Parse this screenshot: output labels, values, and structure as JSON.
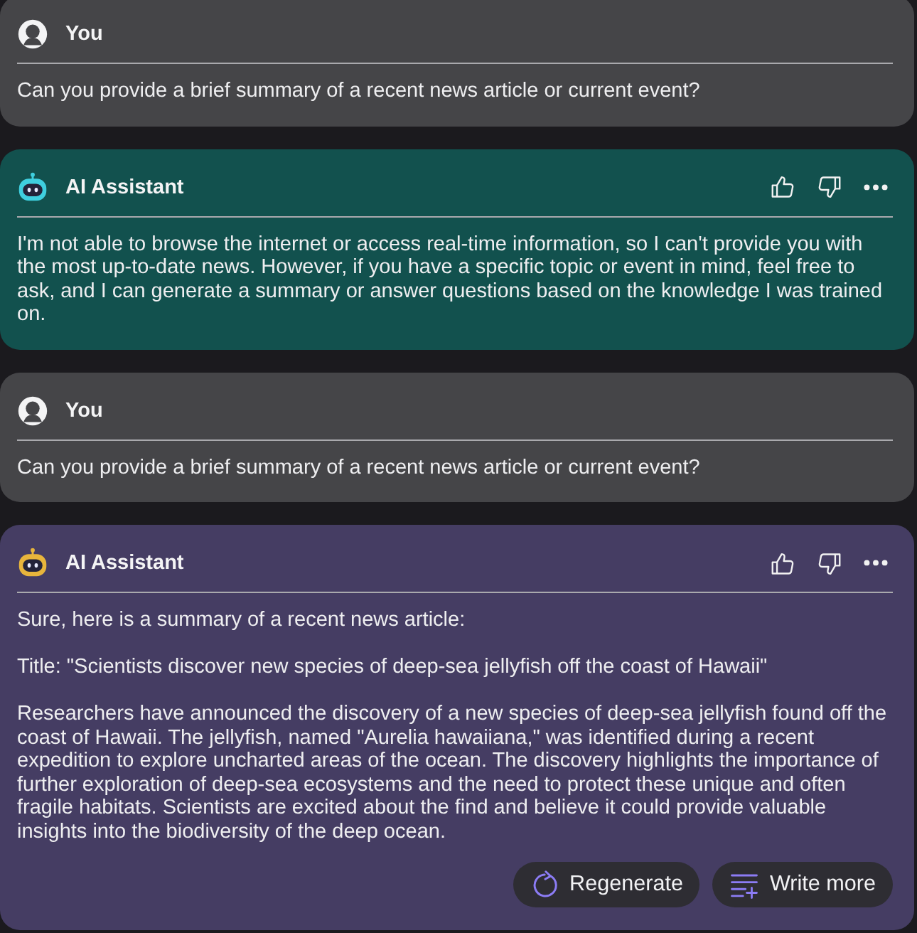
{
  "messages": [
    {
      "kind": "user",
      "author": "You",
      "color": "#454548",
      "paragraphs": [
        "Can you provide a brief summary of a recent news article or current event?"
      ]
    },
    {
      "kind": "assistant",
      "author": "AI Assistant",
      "color": "#12514e",
      "avatar": {
        "color": "#3fcfdf"
      },
      "paragraphs": [
        "I'm not able to browse the internet or access real-time information, so I can't provide you with the most up-to-date news. However, if you have a specific topic or event in mind, feel free to ask, and I can generate a summary or answer questions based on the knowledge I was trained on."
      ]
    },
    {
      "kind": "user",
      "author": "You",
      "color": "#454548",
      "paragraphs": [
        "Can you provide a brief summary of a recent news article or current event?"
      ]
    },
    {
      "kind": "assistant",
      "author": "AI Assistant",
      "color": "#453d63",
      "avatar": {
        "color": "#e8b53c"
      },
      "paragraphs": [
        "Sure, here is a summary of a recent news article:",
        "Title: \"Scientists discover new species of deep-sea jellyfish off the coast of Hawaii\"",
        "Researchers have announced the discovery of a new species of deep-sea jellyfish found off the coast of Hawaii. The jellyfish, named \"Aurelia hawaiiana,\" was identified during a recent expedition to explore uncharted areas of the ocean. The discovery highlights the importance of further exploration of deep-sea ecosystems and the need to protect these unique and often fragile habitats. Scientists are excited about the find and believe it could provide valuable insights into the biodiversity of the deep ocean."
      ],
      "buttons": [
        {
          "kind": "regenerate",
          "label": "Regenerate"
        },
        {
          "kind": "extend",
          "label": "Write more"
        }
      ]
    }
  ]
}
